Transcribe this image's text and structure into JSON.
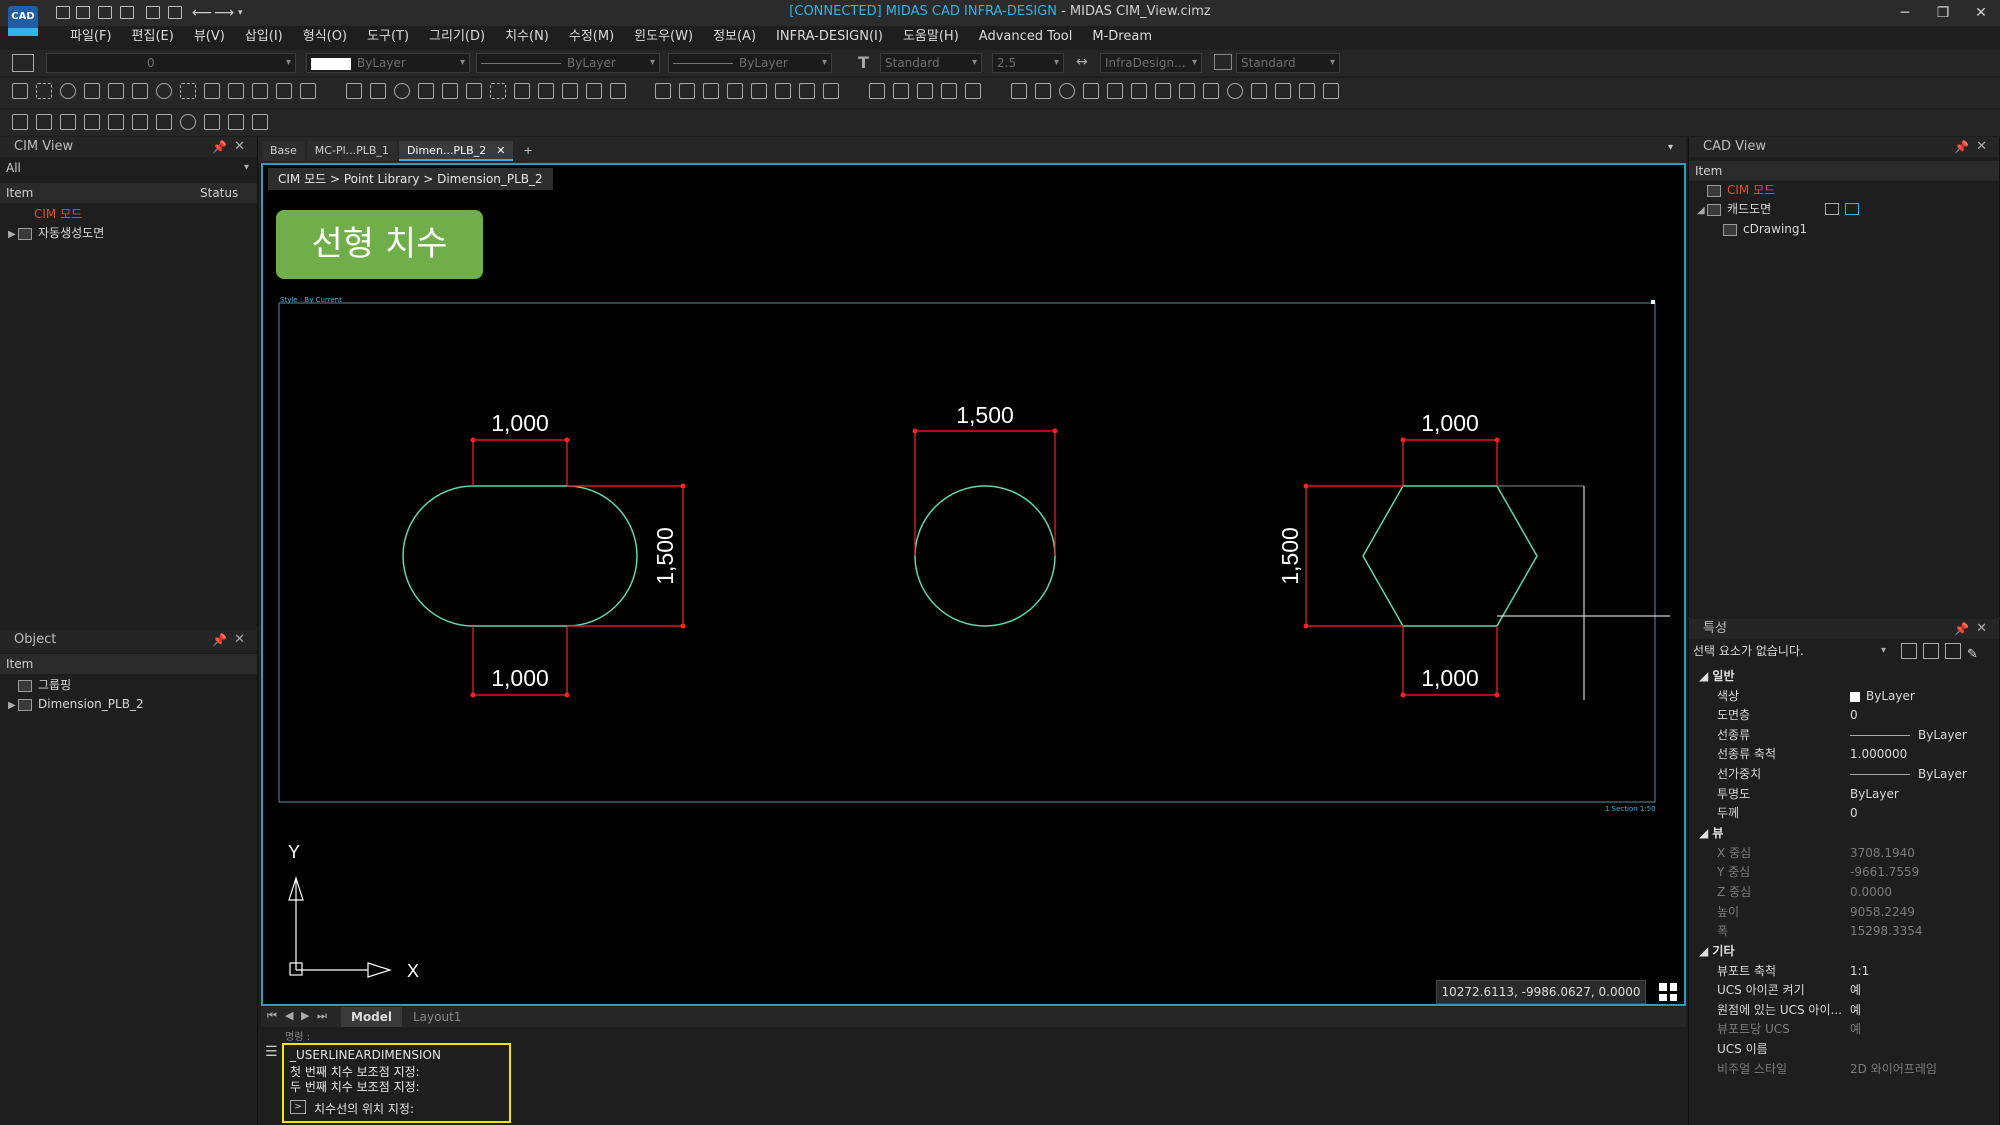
{
  "app": {
    "logo": "CAD",
    "title_connected": "[CONNECTED] MIDAS CAD INFRA-DESIGN",
    "title_file": " - MIDAS CIM_View.cimz"
  },
  "menu": [
    "파일(F)",
    "편집(E)",
    "뷰(V)",
    "삽입(I)",
    "형식(O)",
    "도구(T)",
    "그리기(D)",
    "치수(N)",
    "수정(M)",
    "윈도우(W)",
    "정보(A)",
    "INFRA-DESIGN(I)",
    "도움말(H)",
    "Advanced Tool",
    "M-Dream"
  ],
  "toolbar1": {
    "layer_value": "0",
    "color_value": "ByLayer",
    "linetype_value": "ByLayer",
    "lineweight_value": "ByLayer",
    "text_style": "Standard",
    "text_height": "2.5",
    "dim_style": "InfraDesign...",
    "table_style": "Standard"
  },
  "left_panel": {
    "title": "CIM View",
    "filter": "All",
    "col_item": "Item",
    "col_status": "Status",
    "items": [
      {
        "label": "CIM 모드"
      },
      {
        "label": "자동생성도면"
      }
    ]
  },
  "object_panel": {
    "title": "Object",
    "col_item": "Item",
    "items": [
      {
        "label": "그룹핑"
      },
      {
        "label": "Dimension_PLB_2"
      }
    ]
  },
  "tabs": [
    "Base",
    "MC-Pl...PLB_1",
    "Dimen...PLB_2",
    "+"
  ],
  "breadcrumb": "CIM 모드 > Point Library > Dimension_PLB_2",
  "badge": "선형 치수",
  "viewport": {
    "style_label": "Style : By Current",
    "section_label": "1 Section 1:50",
    "dims": {
      "top_left": "1,000",
      "top_mid": "1,500",
      "top_right": "1,000",
      "bot_left": "1,000",
      "bot_right": "1,000",
      "left_v": "1,500",
      "right_v": "1,500"
    },
    "axis_x": "X",
    "axis_y": "Y"
  },
  "coord": "10272.6113, -9986.0627, 0.0000",
  "layout_tabs": {
    "model": "Model",
    "layout1": "Layout1"
  },
  "command": {
    "header": "명령 :",
    "lines": [
      "_USERLINEARDIMENSION",
      "첫 번째 치수 보조점 지정:",
      "두 번째 치수 보조점 지정:"
    ],
    "prompt": "치수선의 위치 지정:"
  },
  "cad_view": {
    "title": "CAD View",
    "col_item": "Item",
    "items": [
      {
        "label": "CIM 모드"
      },
      {
        "label": "캐드도면"
      },
      {
        "label": "cDrawing1"
      }
    ]
  },
  "properties": {
    "title": "특성",
    "selection": "선택 요소가 없습니다.",
    "sections": {
      "general": "일반",
      "view": "뷰",
      "misc": "기타"
    },
    "general": [
      {
        "k": "색상",
        "v": "ByLayer"
      },
      {
        "k": "도면층",
        "v": "0"
      },
      {
        "k": "선종류",
        "v": "ByLayer"
      },
      {
        "k": "선종류 축척",
        "v": "1.000000"
      },
      {
        "k": "선가중치",
        "v": "ByLayer"
      },
      {
        "k": "투명도",
        "v": "ByLayer"
      },
      {
        "k": "두께",
        "v": "0"
      }
    ],
    "view": [
      {
        "k": "X 중심",
        "v": "3708.1940"
      },
      {
        "k": "Y 중심",
        "v": "-9661.7559"
      },
      {
        "k": "Z 중심",
        "v": "0.0000"
      },
      {
        "k": "높이",
        "v": "9058.2249"
      },
      {
        "k": "폭",
        "v": "15298.3354"
      }
    ],
    "misc": [
      {
        "k": "뷰포트 축척",
        "v": "1:1"
      },
      {
        "k": "UCS 아이콘 켜기",
        "v": "예"
      },
      {
        "k": "원점에 있는 UCS 아이...",
        "v": "예"
      },
      {
        "k": "뷰포트당 UCS",
        "v": "예"
      },
      {
        "k": "UCS 이름",
        "v": ""
      },
      {
        "k": "비주얼 스타일",
        "v": "2D 와이어프레임"
      }
    ]
  },
  "colors": {
    "accent": "#2fb3e8",
    "dim_red": "#ff2020",
    "geometry": "#5fd7b0",
    "badge": "#6fae49",
    "highlight": "#f2e600"
  }
}
